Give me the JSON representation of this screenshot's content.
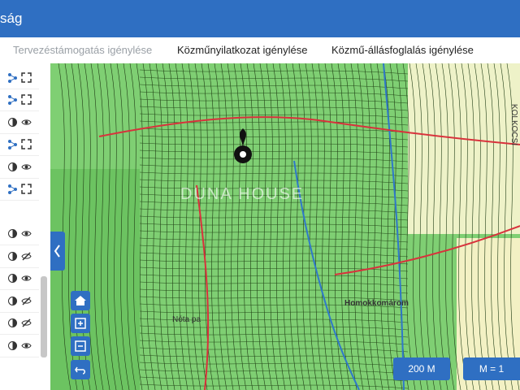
{
  "header": {
    "title": "ság"
  },
  "tabs": [
    {
      "label": "Tervezéstámogatás igénylése",
      "state": "inactive"
    },
    {
      "label": "Közműnyilatkozat igénylése",
      "state": "active"
    },
    {
      "label": "Közmű-állásfoglalás igénylése",
      "state": "active"
    }
  ],
  "sidebar": {
    "rows": [
      {
        "left_icon": "node-link-icon",
        "right_icon": "expand-icon"
      },
      {
        "left_icon": "node-link-icon",
        "right_icon": "expand-icon"
      },
      {
        "left_icon": "contrast-icon",
        "right_icon": "eye-icon"
      },
      {
        "left_icon": "node-link-icon",
        "right_icon": "expand-icon"
      },
      {
        "left_icon": "contrast-icon",
        "right_icon": "eye-icon"
      },
      {
        "left_icon": "node-link-icon",
        "right_icon": "expand-icon"
      },
      {
        "left_icon": "contrast-icon",
        "right_icon": "eye-icon"
      },
      {
        "left_icon": "contrast-icon",
        "right_icon": "eye-off-icon"
      },
      {
        "left_icon": "contrast-icon",
        "right_icon": "eye-icon"
      },
      {
        "left_icon": "contrast-icon",
        "right_icon": "eye-off-icon"
      },
      {
        "left_icon": "contrast-icon",
        "right_icon": "eye-off-icon"
      },
      {
        "left_icon": "contrast-icon",
        "right_icon": "eye-icon"
      }
    ]
  },
  "map": {
    "labels": {
      "town": "Homokkomárom",
      "place": "Nóta pa",
      "road": "KOLKOCSI"
    },
    "watermark": "DUNA HOUSE",
    "scale": "200 M",
    "ratio": "M = 1",
    "colors": {
      "parcel": "#7fcf73",
      "parcel_line": "#1f3b14",
      "road_red": "#d8323c",
      "water_blue": "#2f78c9",
      "town": "#eef2c8"
    }
  },
  "controls": {
    "home_icon": "home-icon",
    "zoom_in_icon": "plus-icon",
    "zoom_out_icon": "minus-icon",
    "back_icon": "undo-icon",
    "collapse_icon": "chevron-left-icon"
  }
}
